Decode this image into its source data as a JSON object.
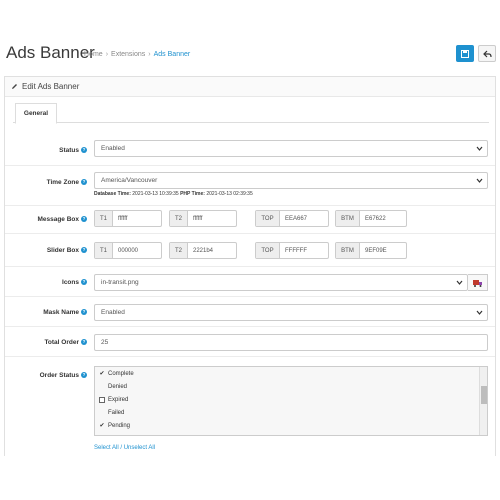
{
  "header": {
    "title": "Ads Banner",
    "breadcrumb": [
      "Home",
      "Extensions",
      "Ads Banner"
    ],
    "save_icon": "save-icon",
    "back_icon": "reply-icon",
    "accent": "#1e91cf"
  },
  "panel": {
    "heading": "Edit Ads Banner",
    "tab": "General"
  },
  "form": {
    "status": {
      "label": "Status",
      "value": "Enabled"
    },
    "timezone": {
      "label": "Time Zone",
      "value": "America/Vancouver",
      "db_label": "Database Time:",
      "db_value": "2021-03-13 10:39:35",
      "php_label": "PHP Time:",
      "php_value": "2021-03-13 02:39:35"
    },
    "message_box": {
      "label": "Message Box",
      "t1_label": "T1",
      "t1": "ffffff",
      "t2_label": "T2",
      "t2": "ffffff",
      "top_label": "TOP",
      "top": "EEA667",
      "btm_label": "BTM",
      "btm": "E67622"
    },
    "slider_box": {
      "label": "Slider Box",
      "t1_label": "T1",
      "t1": "000000",
      "t2_label": "T2",
      "t2": "2221b4",
      "top_label": "TOP",
      "top": "FFFFFF",
      "btm_label": "BTM",
      "btm": "9EF09E"
    },
    "icons": {
      "label": "Icons",
      "value": "in-transit.png"
    },
    "mask_name": {
      "label": "Mask Name",
      "value": "Enabled"
    },
    "total_order": {
      "label": "Total Order",
      "value": "25"
    },
    "order_status": {
      "label": "Order Status",
      "items": [
        {
          "label": "Complete",
          "checked": true
        },
        {
          "label": "Denied",
          "checked": false
        },
        {
          "label": "Expired",
          "checked": false
        },
        {
          "label": "Failed",
          "checked": false
        },
        {
          "label": "Pending",
          "checked": true
        }
      ],
      "select_all": "Select All",
      "divider": "/",
      "unselect_all": "Unselect All"
    }
  }
}
